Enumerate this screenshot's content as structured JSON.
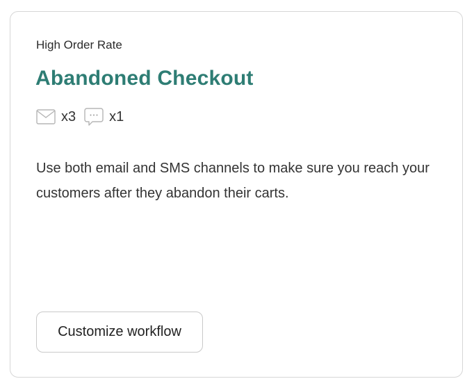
{
  "card": {
    "eyebrow": "High Order Rate",
    "title": "Abandoned Checkout",
    "channels": [
      {
        "icon": "mail-icon",
        "count": "x3"
      },
      {
        "icon": "chat-bubble-icon",
        "count": "x1"
      }
    ],
    "description": "Use both email and SMS channels to make sure you reach your customers after they abandon their carts.",
    "button_label": "Customize workflow"
  },
  "colors": {
    "title": "#2e7d74",
    "border": "#d6d6d6",
    "icon": "#b5b5b5",
    "text": "#333333"
  }
}
